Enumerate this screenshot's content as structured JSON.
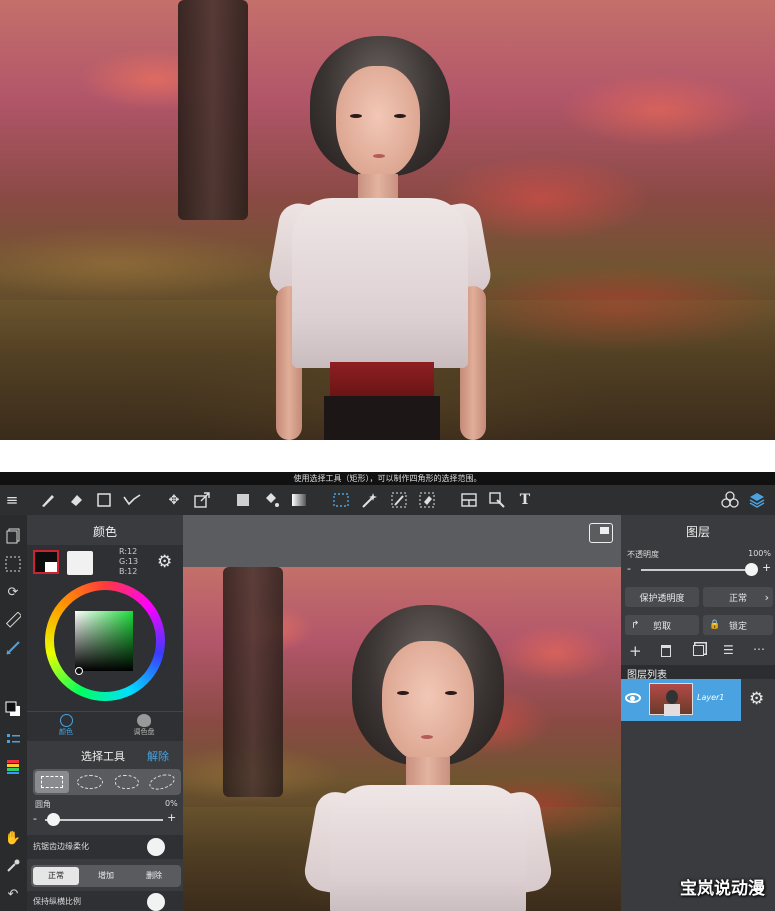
{
  "app": {
    "hint_text": "使用选择工具（矩形），可以制作四角形的选择范围。",
    "color_panel": {
      "title": "颜色",
      "rgb": {
        "r": "R:12",
        "g": "G:13",
        "b": "B:12"
      },
      "tabs": [
        {
          "label": "颜色"
        },
        {
          "label": "调色盘"
        }
      ]
    },
    "select_tool": {
      "title": "选择工具",
      "clear_label": "解除",
      "corner_label": "圆角",
      "corner_value": "0%",
      "corner_level": 0,
      "antialias_label": "抗锯齿边缘柔化",
      "antialias_on": true,
      "modes": [
        "正常",
        "增加",
        "删除"
      ],
      "selected_mode": "正常",
      "keep_ratio_label": "保持纵横比例",
      "keep_ratio_on": true
    },
    "layers_panel": {
      "title": "图层",
      "opacity_label": "不透明度",
      "opacity_value": "100%",
      "opacity_level": 1.0,
      "protect_alpha_label": "保护透明度",
      "blend_mode": "正常",
      "clip_label": "剪取",
      "lock_label": "锁定",
      "list_title": "图层列表",
      "layer_name": "Layer1"
    },
    "accent_color": "#4aa3e0"
  },
  "watermark": "宝岚说动漫"
}
